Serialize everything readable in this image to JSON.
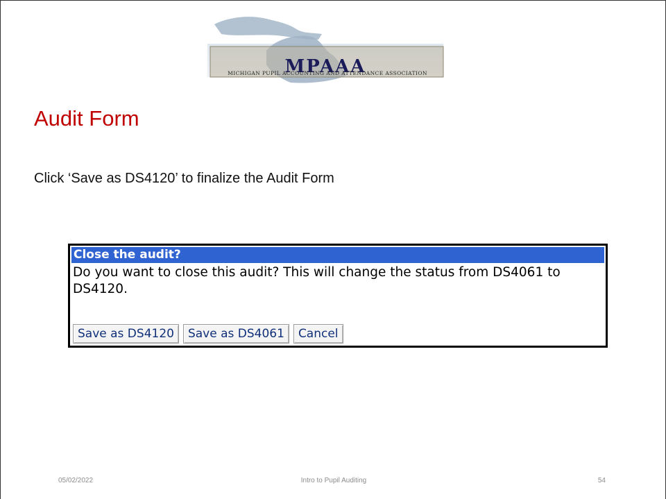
{
  "logo": {
    "main_text": "MPAAA",
    "sub_text": "Michigan Pupil Accounting and Attendance Association"
  },
  "slide": {
    "title": "Audit Form",
    "body": "Click ‘Save as DS4120’ to finalize the Audit Form"
  },
  "dialog": {
    "title": "Close the audit?",
    "message": "Do you want to close this audit? This will change the status from DS4061 to DS4120.",
    "buttons": {
      "save_ds4120": "Save as DS4120",
      "save_ds4061": "Save as DS4061",
      "cancel": "Cancel"
    }
  },
  "footer": {
    "date": "05/02/2022",
    "title": "Intro to Pupil Auditing",
    "page": "54"
  },
  "colors": {
    "title_red": "#c00000",
    "dialog_title_bg": "#2f63d1"
  }
}
